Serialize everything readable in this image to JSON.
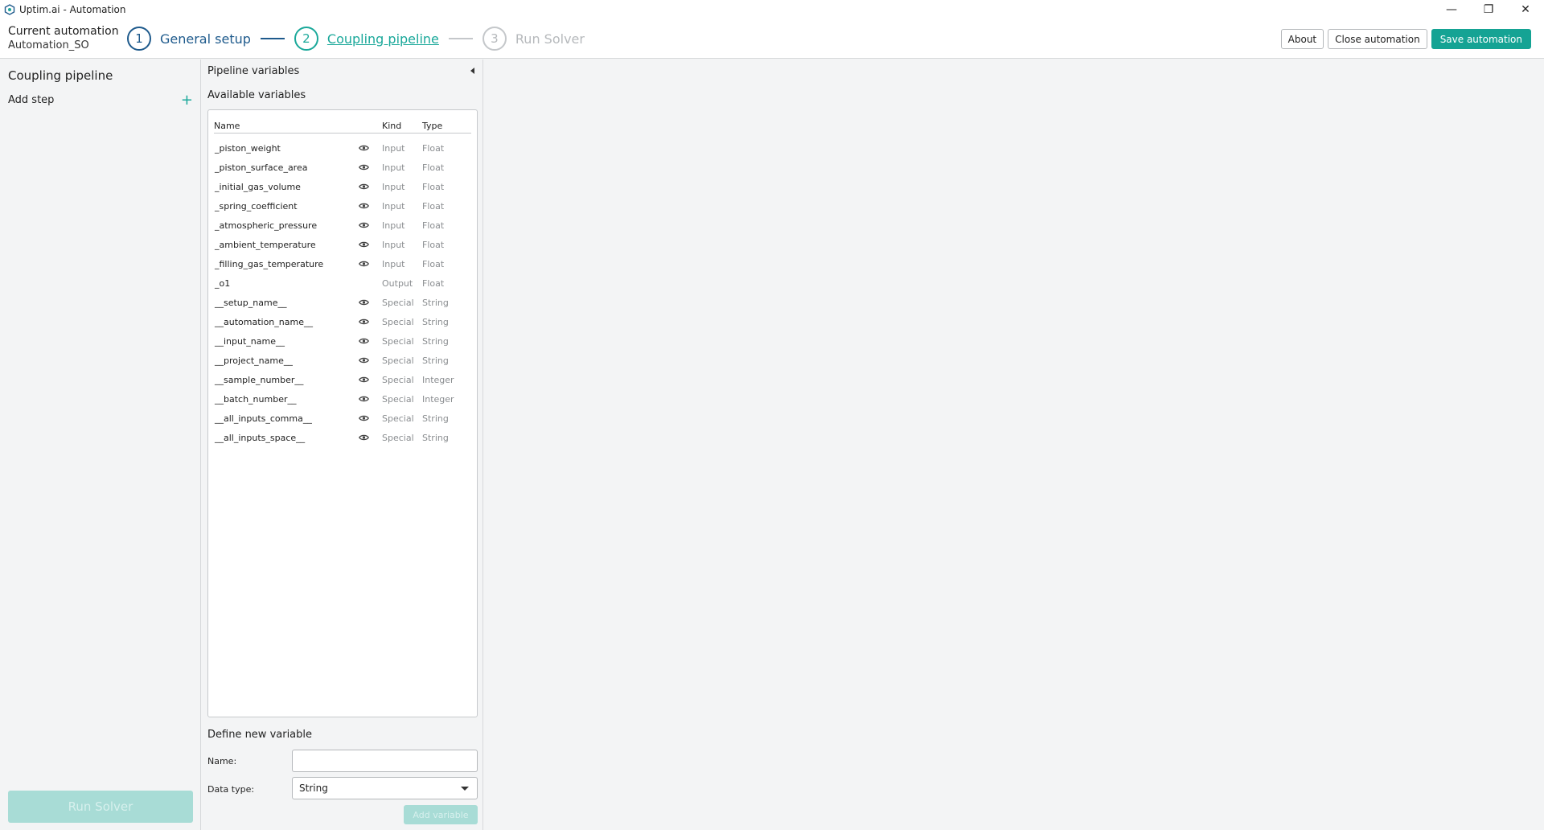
{
  "window": {
    "title": "Uptim.ai - Automation",
    "controls": {
      "minimize": "—",
      "maximize": "❐",
      "close": "✕"
    }
  },
  "header": {
    "current_label": "Current automation",
    "current_name": "Automation_SO",
    "steps": [
      {
        "number": "1",
        "label": "General setup",
        "state": "done"
      },
      {
        "number": "2",
        "label": "Coupling pipeline",
        "state": "active"
      },
      {
        "number": "3",
        "label": "Run Solver",
        "state": "disabled"
      }
    ],
    "about_label": "About",
    "close_label": "Close automation",
    "save_label": "Save automation"
  },
  "sidebar": {
    "title": "Coupling pipeline",
    "add_step_label": "Add step",
    "run_solver_label": "Run Solver"
  },
  "pipeline": {
    "title": "Pipeline variables",
    "available_title": "Available variables",
    "columns": {
      "name": "Name",
      "kind": "Kind",
      "type": "Type"
    },
    "variables": [
      {
        "name": "_piston_weight",
        "visible": true,
        "kind": "Input",
        "type": "Float"
      },
      {
        "name": "_piston_surface_area",
        "visible": true,
        "kind": "Input",
        "type": "Float"
      },
      {
        "name": "_initial_gas_volume",
        "visible": true,
        "kind": "Input",
        "type": "Float"
      },
      {
        "name": "_spring_coefficient",
        "visible": true,
        "kind": "Input",
        "type": "Float"
      },
      {
        "name": "_atmospheric_pressure",
        "visible": true,
        "kind": "Input",
        "type": "Float"
      },
      {
        "name": "_ambient_temperature",
        "visible": true,
        "kind": "Input",
        "type": "Float"
      },
      {
        "name": "_filling_gas_temperature",
        "visible": true,
        "kind": "Input",
        "type": "Float"
      },
      {
        "name": "_o1",
        "visible": false,
        "kind": "Output",
        "type": "Float"
      },
      {
        "name": "__setup_name__",
        "visible": true,
        "kind": "Special",
        "type": "String"
      },
      {
        "name": "__automation_name__",
        "visible": true,
        "kind": "Special",
        "type": "String"
      },
      {
        "name": "__input_name__",
        "visible": true,
        "kind": "Special",
        "type": "String"
      },
      {
        "name": "__project_name__",
        "visible": true,
        "kind": "Special",
        "type": "String"
      },
      {
        "name": "__sample_number__",
        "visible": true,
        "kind": "Special",
        "type": "Integer"
      },
      {
        "name": "__batch_number__",
        "visible": true,
        "kind": "Special",
        "type": "Integer"
      },
      {
        "name": "__all_inputs_comma__",
        "visible": true,
        "kind": "Special",
        "type": "String"
      },
      {
        "name": "__all_inputs_space__",
        "visible": true,
        "kind": "Special",
        "type": "String"
      }
    ],
    "define_title": "Define new variable",
    "name_label": "Name:",
    "name_value": "",
    "data_type_label": "Data type:",
    "data_type_value": "String",
    "add_variable_label": "Add variable"
  },
  "colors": {
    "accent": "#15a394",
    "step_done": "#1e5a8c",
    "disabled_fill": "#a8dcd6",
    "border": "#d6d8da"
  }
}
